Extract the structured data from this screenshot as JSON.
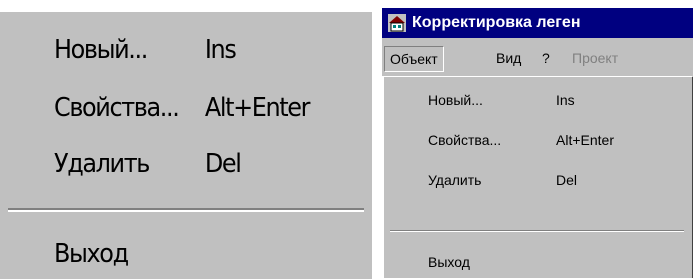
{
  "zoomed_menu": {
    "items": [
      {
        "label": "Новый...",
        "shortcut": "Ins"
      },
      {
        "label": "Свойства...",
        "shortcut": "Alt+Enter"
      },
      {
        "label": "Удалить",
        "shortcut": "Del"
      }
    ],
    "exit_label": "Выход"
  },
  "window": {
    "title": "Корректировка леген",
    "menubar": {
      "object": "Объект",
      "view": "Вид",
      "help": "?",
      "project": "Проект"
    },
    "dropdown": {
      "items": [
        {
          "label": "Новый...",
          "shortcut": "Ins"
        },
        {
          "label": "Свойства...",
          "shortcut": "Alt+Enter"
        },
        {
          "label": "Удалить",
          "shortcut": "Del"
        }
      ],
      "exit_label": "Выход"
    }
  },
  "colors": {
    "face": "#c0c0c0",
    "titlebar": "#000080",
    "disabled_text": "#808080"
  }
}
